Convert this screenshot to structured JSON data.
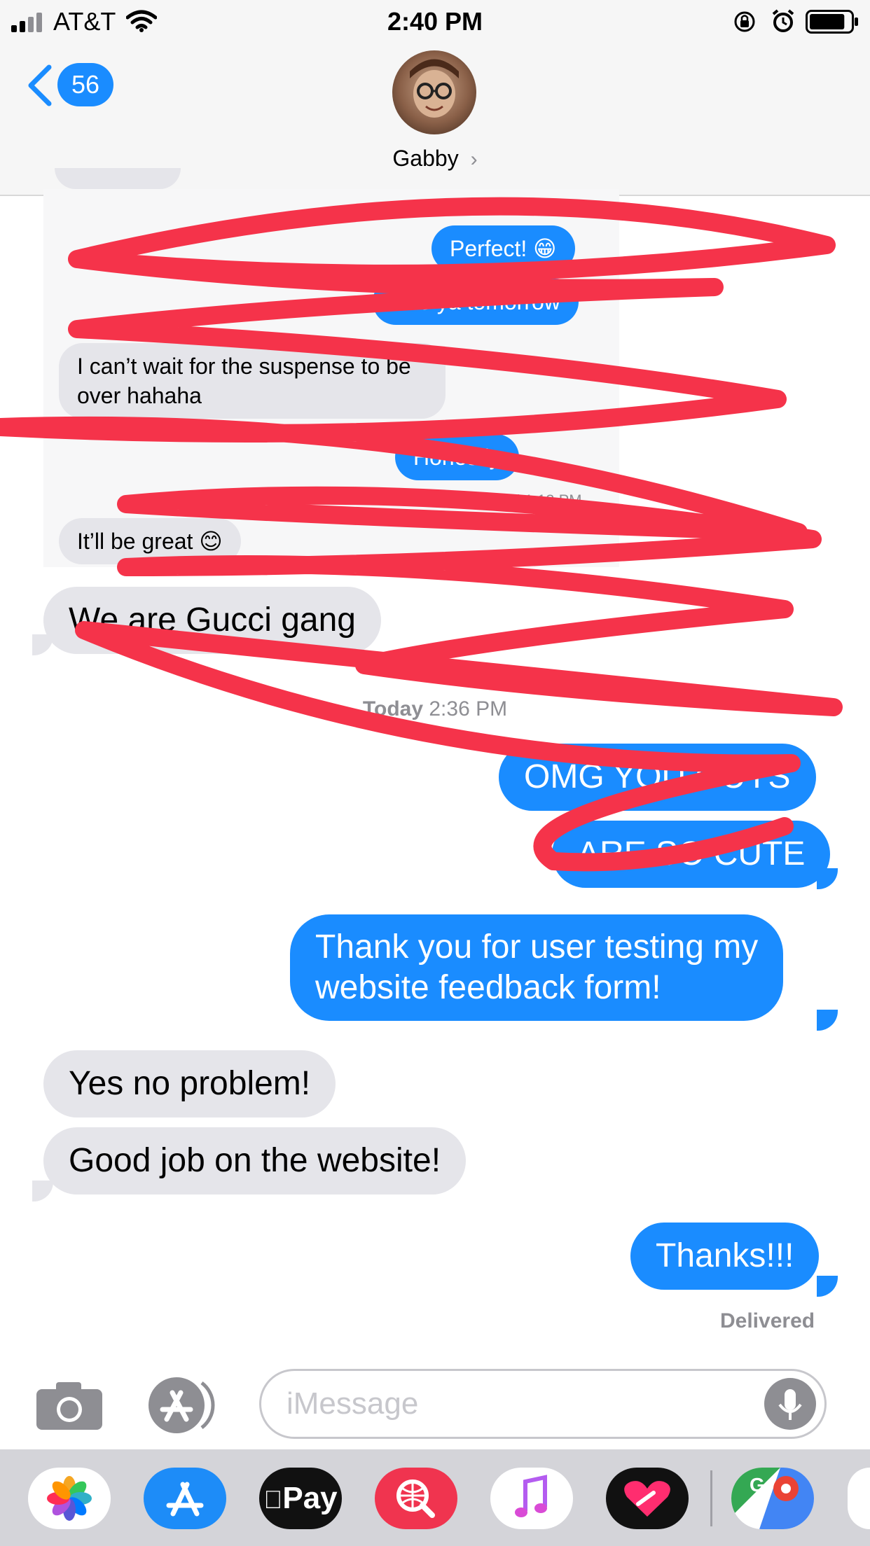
{
  "status_bar": {
    "carrier": "AT&T",
    "time": "2:40 PM",
    "battery_level": 0.85
  },
  "header": {
    "back_count": "56",
    "contact_name": "Gabby"
  },
  "screenshot_messages": [
    {
      "dir": "out",
      "text": "Perfect! 😁"
    },
    {
      "dir": "out",
      "text": "See ya tomorrow"
    },
    {
      "dir": "in",
      "text": "I can’t wait for the suspense to be over hahaha"
    },
    {
      "dir": "out",
      "text": "Honestly"
    },
    {
      "dir": "in",
      "text": "It’ll be great 😊"
    }
  ],
  "screenshot_read": "Read 1:13 PM",
  "scribble_color": "#f5334a",
  "messages": {
    "gucci": "We are Gucci gang",
    "timestamp_day": "Today",
    "timestamp_time": "2:36 PM",
    "omg": "OMG YOU GUYS",
    "cute": "ARE SO CUTE",
    "thank_line1": "Thank you for user testing my",
    "thank_line2": "website feedback form!",
    "yes": "Yes no problem!",
    "good": "Good job on the website!",
    "thanks": "Thanks!!!",
    "delivered": "Delivered"
  },
  "composer": {
    "placeholder": "iMessage"
  },
  "app_drawer": {
    "apps": [
      "photos-icon",
      "app-store-icon",
      "apple-pay-icon",
      "search-images-icon",
      "music-icon",
      "heart-app-icon",
      "maps-icon"
    ],
    "apple_pay_label": "Pay",
    "maps_letter": "G"
  },
  "colors": {
    "bubble_out": "#1a8cff",
    "bubble_in": "#e5e5ea"
  }
}
